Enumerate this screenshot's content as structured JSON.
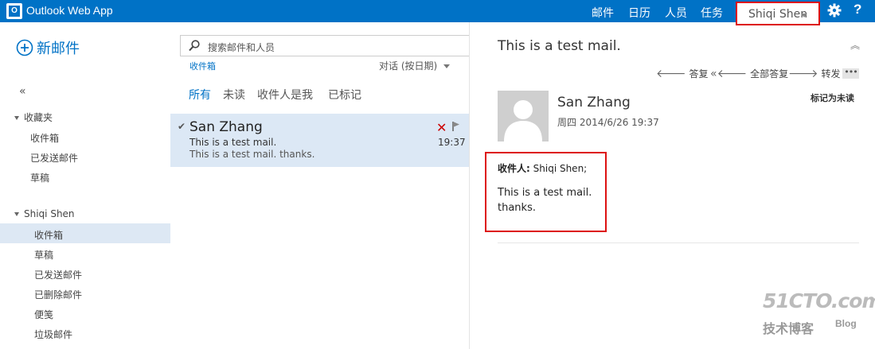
{
  "app": {
    "title": "Outlook Web App",
    "logo_letter": "O"
  },
  "topnav": {
    "mail": "邮件",
    "calendar": "日历",
    "people": "人员",
    "tasks": "任务",
    "user": "Shiqi Shen",
    "help": "?"
  },
  "left": {
    "new_mail": "新邮件",
    "collapse": "«",
    "favorites": {
      "label": "收藏夹",
      "items": [
        "收件箱",
        "已发送邮件",
        "草稿"
      ]
    },
    "account": {
      "label": "Shiqi Shen",
      "items": [
        "收件箱",
        "草稿",
        "已发送邮件",
        "已删除邮件",
        "便笺",
        "垃圾邮件"
      ],
      "selected": "收件箱"
    }
  },
  "middle": {
    "search_placeholder": "搜索邮件和人员",
    "folder_crumb": "收件箱",
    "sort_label": "对话 (按日期)",
    "filters": [
      "所有",
      "未读",
      "收件人是我",
      "已标记"
    ],
    "active_filter": "所有",
    "messages": [
      {
        "sender": "San Zhang",
        "subject": "This is a test mail.",
        "preview": "This is a test mail.  thanks.",
        "time": "19:37"
      }
    ]
  },
  "reading": {
    "subject": "This is a test mail.",
    "actions": {
      "reply": "答复",
      "reply_all": "全部答复",
      "forward": "转发"
    },
    "mark_unread": "标记为未读",
    "from": "San Zhang",
    "date": "周四 2014/6/26 19:37",
    "to_label": "收件人:",
    "to_value": "Shiqi Shen;",
    "body_lines": [
      "This is a test mail.",
      "thanks."
    ]
  },
  "watermark": {
    "main": "51CTO.com",
    "sub": "技术博客",
    "blog": "Blog"
  },
  "colors": {
    "accent": "#0072c6",
    "selection": "#dce8f5",
    "highlight_border": "#dd1111"
  }
}
